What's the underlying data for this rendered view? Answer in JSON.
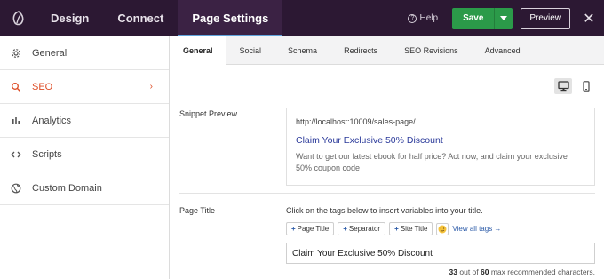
{
  "topbar": {
    "tabs": [
      {
        "label": "Design"
      },
      {
        "label": "Connect"
      },
      {
        "label": "Page Settings"
      }
    ],
    "help_label": "Help",
    "save_label": "Save",
    "preview_label": "Preview",
    "close_glyph": "✕"
  },
  "sidebar": {
    "items": [
      {
        "label": "General",
        "icon": "gear-icon"
      },
      {
        "label": "SEO",
        "icon": "search-icon",
        "active": true
      },
      {
        "label": "Analytics",
        "icon": "bar-chart-icon"
      },
      {
        "label": "Scripts",
        "icon": "code-icon"
      },
      {
        "label": "Custom Domain",
        "icon": "globe-icon"
      }
    ],
    "chevron": "›"
  },
  "subtabs": [
    {
      "label": "General"
    },
    {
      "label": "Social"
    },
    {
      "label": "Schema"
    },
    {
      "label": "Redirects"
    },
    {
      "label": "SEO Revisions"
    },
    {
      "label": "Advanced"
    }
  ],
  "snippet": {
    "label": "Snippet Preview",
    "url": "http://localhost:10009/sales-page/",
    "title": "Claim Your Exclusive 50% Discount",
    "description": "Want to get our latest ebook for half price? Act now, and claim your exclusive 50% coupon code"
  },
  "page_title": {
    "label": "Page Title",
    "hint": "Click on the tags below to insert variables into your title.",
    "tags": [
      "Page Title",
      "Separator",
      "Site Title"
    ],
    "view_all": "View all tags →",
    "value": "Claim Your Exclusive 50% Discount",
    "count_current": "33",
    "count_text_mid": " out of ",
    "count_max": "60",
    "count_suffix": " max recommended characters."
  },
  "colors": {
    "topbar_bg": "#2c1833",
    "save_green": "#2b9a49",
    "accent_orange": "#dd4b24",
    "link_blue": "#2b3a9a"
  }
}
